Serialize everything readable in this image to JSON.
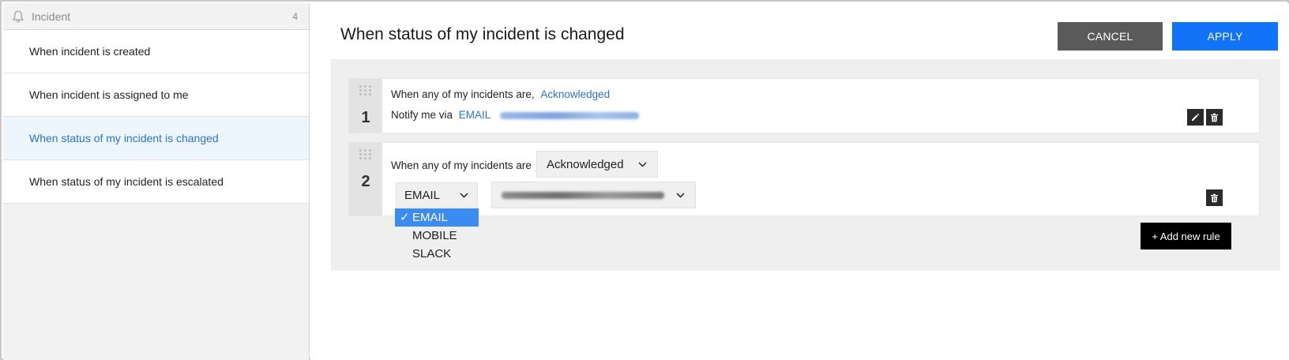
{
  "sidebar": {
    "header": {
      "title": "Incident",
      "count": "4",
      "icon": "bell-icon"
    },
    "items": [
      {
        "label": "When incident is created",
        "active": false
      },
      {
        "label": "When incident is assigned to me",
        "active": false
      },
      {
        "label": "When status of my incident is changed",
        "active": true
      },
      {
        "label": "When status of my incident is escalated",
        "active": false
      }
    ]
  },
  "main": {
    "title": "When status of my incident is changed",
    "cancel_label": "CANCEL",
    "apply_label": "APPLY",
    "rules": [
      {
        "number": "1",
        "condition_prefix": "When any of my incidents are,",
        "condition_value": "Acknowledged",
        "notify_prefix": "Notify me via",
        "notify_channel": "EMAIL"
      },
      {
        "number": "2",
        "condition_prefix": "When any of my incidents are",
        "status_select": "Acknowledged",
        "channel_select": "EMAIL"
      }
    ],
    "channel_dropdown": {
      "options": [
        "EMAIL",
        "MOBILE",
        "SLACK"
      ],
      "selected": "EMAIL",
      "check": "✓"
    },
    "add_rule_label": "+ Add new rule"
  },
  "colors": {
    "accent": "#1173f7",
    "link": "#2a74d6",
    "active_bg": "#edf5fd",
    "cancel_bg": "#5a5a5a",
    "dropdown_selected": "#3b8cf1"
  }
}
